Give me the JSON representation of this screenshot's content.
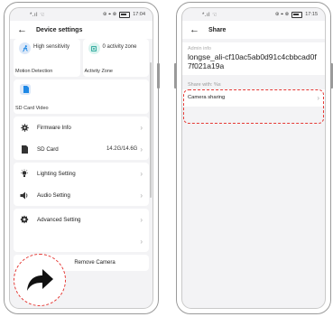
{
  "left_screen": {
    "status": {
      "signal": "*.ıl ☜",
      "icons": "⊛ ⌖ ⊗",
      "time": "17:04"
    },
    "header": {
      "back_icon": "arrow-left-icon",
      "title": "Device settings"
    },
    "motion_tile": {
      "value": "High sensitivity",
      "label": "Motion Detection",
      "icon": "walking-person-icon"
    },
    "activity_tile": {
      "value": "0 activity zone",
      "label": "Activity Zone",
      "icon": "zone-icon"
    },
    "sd_video": {
      "label": "SD Card Video",
      "icon": "sd-card-icon"
    },
    "rows": [
      {
        "label": "Firmware Info",
        "value": "",
        "icon": "gear-icon"
      },
      {
        "label": "SD Card",
        "value": "14.2G/14.6G",
        "icon": "sd-card-icon"
      },
      {
        "label": "Lighting Setting",
        "value": "",
        "icon": "lightbulb-icon"
      },
      {
        "label": "Audio Setting",
        "value": "",
        "icon": "speaker-icon"
      },
      {
        "label": "Advanced Setting",
        "value": "",
        "icon": "settings-icon"
      },
      {
        "label": "",
        "value": "",
        "icon": ""
      }
    ],
    "remove_label": "Remove Camera",
    "share_arrow_icon": "share-arrow-icon"
  },
  "right_screen": {
    "status": {
      "signal": "*.ıl ☜",
      "icons": "⊛ ⌖ ⊗",
      "time": "17:15"
    },
    "header": {
      "back_icon": "arrow-left-icon",
      "title": "Share"
    },
    "admin_label": "Admin info",
    "admin_value": "longse_ali-cf10ac5ab0d91c4cbbcad0f7f021a19a",
    "share_with_label": "Share with: %s",
    "camera_sharing_label": "Camera sharing"
  },
  "colors": {
    "accent": "#1e88e5",
    "highlight": "#e53935",
    "background": "#f3f3f5"
  }
}
